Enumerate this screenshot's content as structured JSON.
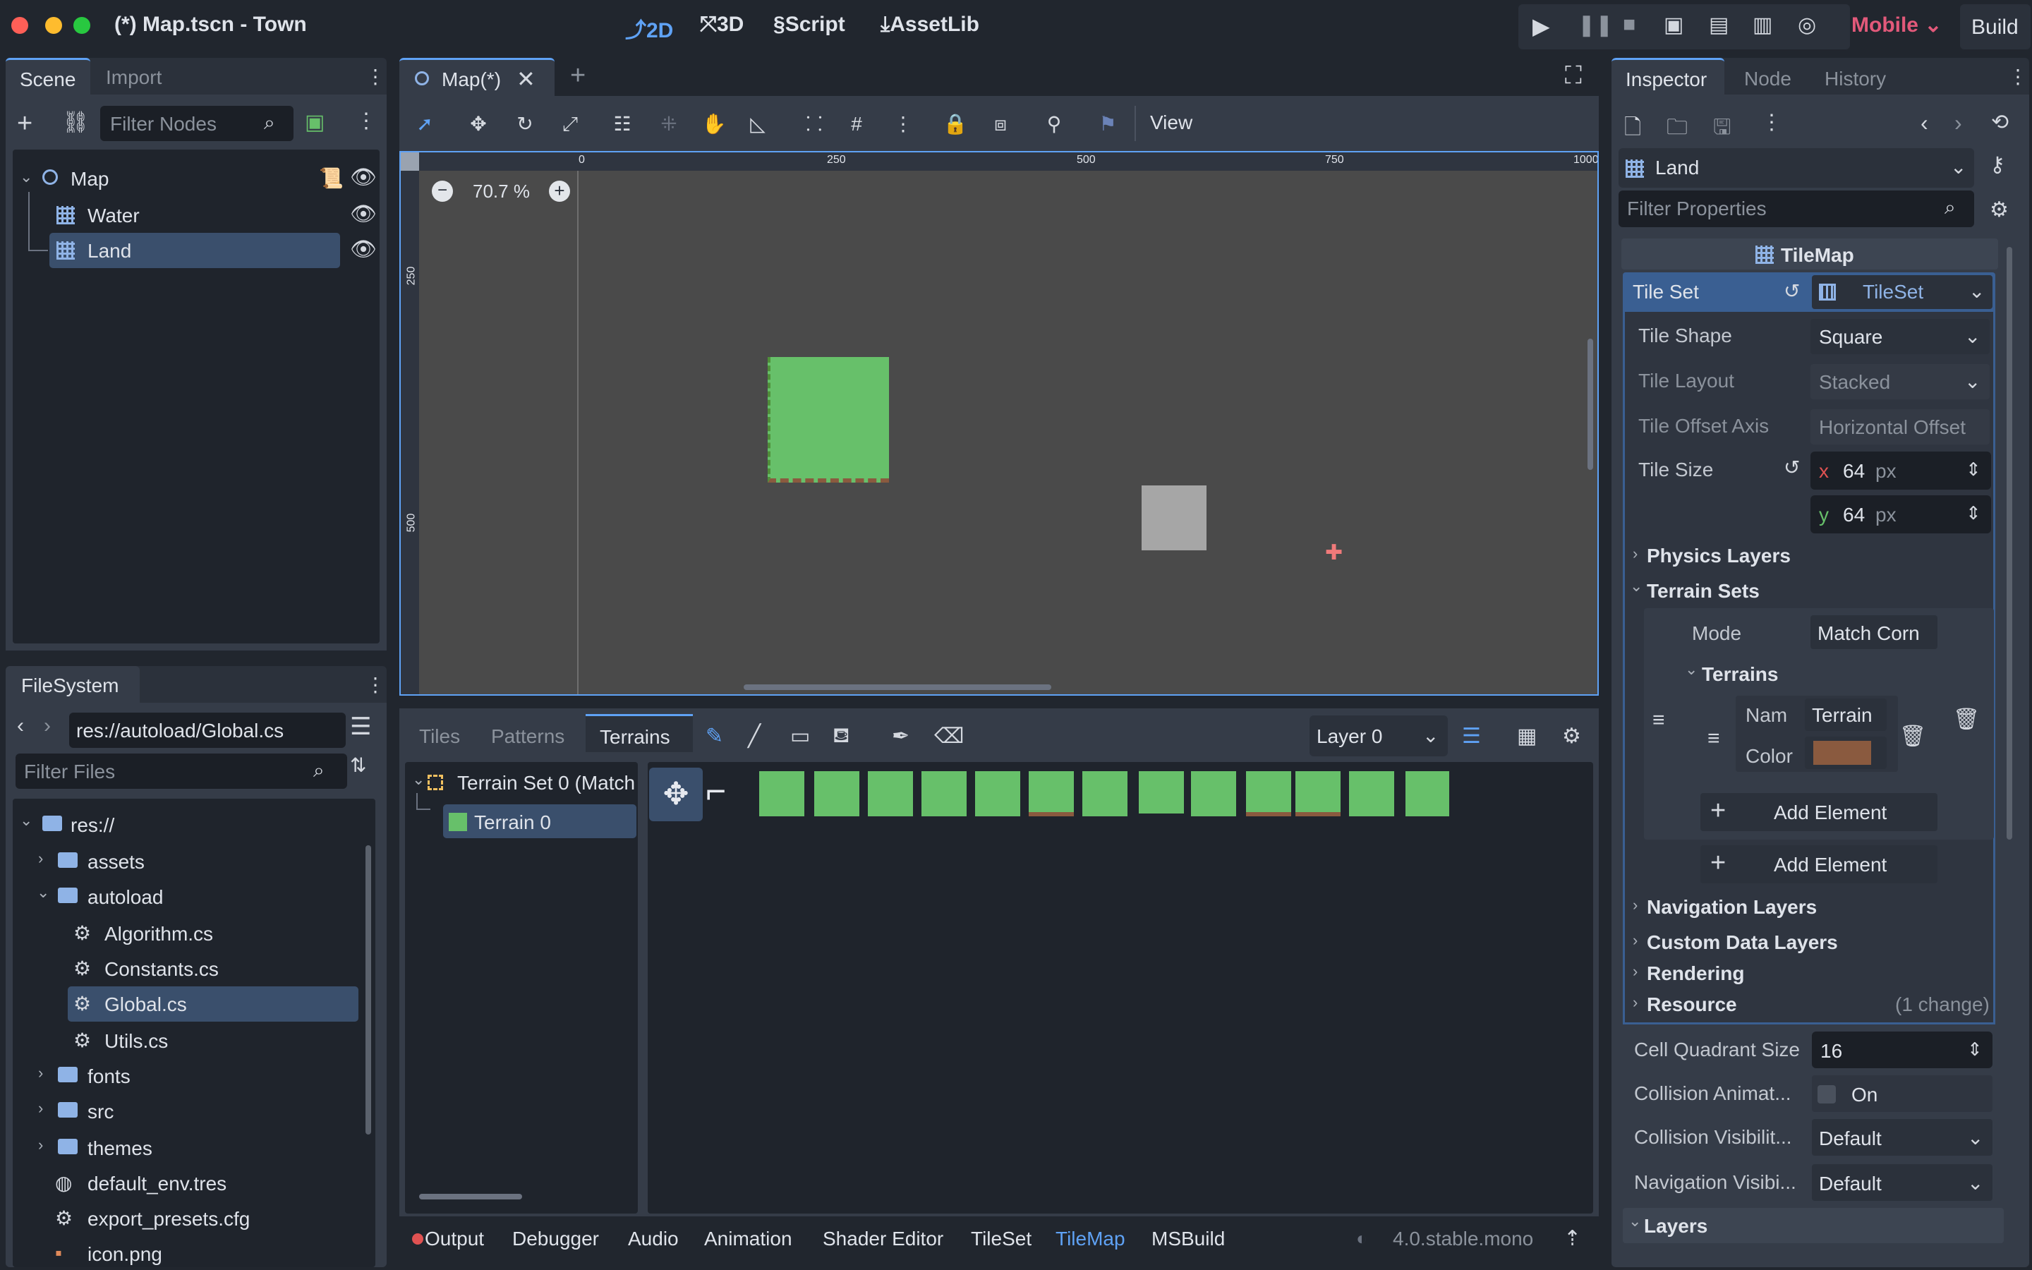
{
  "window": {
    "title": "(*) Map.tscn - Town"
  },
  "topbar": {
    "mode_2d": "2D",
    "mode_3d": "3D",
    "script": "Script",
    "assetlib": "AssetLib",
    "renderer": "Mobile",
    "build": "Build"
  },
  "scene_dock": {
    "tab_scene": "Scene",
    "tab_import": "Import",
    "filter_placeholder": "Filter Nodes",
    "nodes": [
      {
        "label": "Map"
      },
      {
        "label": "Water"
      },
      {
        "label": "Land"
      }
    ]
  },
  "filesystem": {
    "tab": "FileSystem",
    "path": "res://autoload/Global.cs",
    "filter_placeholder": "Filter Files",
    "items": [
      {
        "label": "res://"
      },
      {
        "label": "assets"
      },
      {
        "label": "autoload"
      },
      {
        "label": "Algorithm.cs"
      },
      {
        "label": "Constants.cs"
      },
      {
        "label": "Global.cs"
      },
      {
        "label": "Utils.cs"
      },
      {
        "label": "fonts"
      },
      {
        "label": "src"
      },
      {
        "label": "themes"
      },
      {
        "label": "default_env.tres"
      },
      {
        "label": "export_presets.cfg"
      },
      {
        "label": "icon.png"
      }
    ]
  },
  "editor": {
    "tab": "Map(*)",
    "view_menu": "View",
    "zoom": "70.7 %",
    "ruler_top": [
      "0",
      "250",
      "500",
      "750",
      "1000"
    ],
    "ruler_left": [
      "250",
      "500"
    ]
  },
  "tilemap_panel": {
    "tabs": [
      "Tiles",
      "Patterns",
      "Terrains"
    ],
    "layer": "Layer 0",
    "tree": {
      "set": "Terrain Set 0 (Match",
      "terrain": "Terrain 0"
    }
  },
  "bottom_bar": {
    "tabs": [
      "Output",
      "Debugger",
      "Audio",
      "Animation",
      "Shader Editor",
      "TileSet",
      "TileMap",
      "MSBuild"
    ],
    "version": "4.0.stable.mono"
  },
  "inspector": {
    "tabs": [
      "Inspector",
      "Node",
      "History"
    ],
    "object": "Land",
    "filter_placeholder": "Filter Properties",
    "class_header": "TileMap",
    "tile_set_label": "Tile Set",
    "tile_set_value": "TileSet",
    "tile_shape": {
      "label": "Tile Shape",
      "value": "Square"
    },
    "tile_layout": {
      "label": "Tile Layout",
      "value": "Stacked"
    },
    "tile_offset_axis": {
      "label": "Tile Offset Axis",
      "value": "Horizontal Offset"
    },
    "tile_size": {
      "label": "Tile Size",
      "x_axis": "x",
      "x": "64",
      "y_axis": "y",
      "y": "64",
      "unit": "px"
    },
    "physics_layers": "Physics Layers",
    "terrain_sets": "Terrain Sets",
    "mode": {
      "label": "Mode",
      "value": "Match Corn"
    },
    "terrains": "Terrains",
    "name": {
      "label": "Nam",
      "value": "Terrain"
    },
    "color": {
      "label": "Color",
      "value": "#8a5a3f"
    },
    "add_element_inner": "Add Element",
    "add_element_outer": "Add Element",
    "navigation_layers": "Navigation Layers",
    "custom_data_layers": "Custom Data Layers",
    "rendering": "Rendering",
    "resource": "Resource",
    "resource_changes": "(1 change)",
    "cell_quadrant": {
      "label": "Cell Quadrant Size",
      "value": "16"
    },
    "collision_anim": {
      "label": "Collision Animat...",
      "value": "On"
    },
    "collision_vis": {
      "label": "Collision Visibilit...",
      "value": "Default"
    },
    "nav_vis": {
      "label": "Navigation Visibi...",
      "value": "Default"
    },
    "layers": "Layers"
  },
  "colors": {
    "accent": "#5fa2f5",
    "renderer": "#e2597a",
    "terrain_green": "#67c06a",
    "terrain_color": "#8a5a3f"
  }
}
